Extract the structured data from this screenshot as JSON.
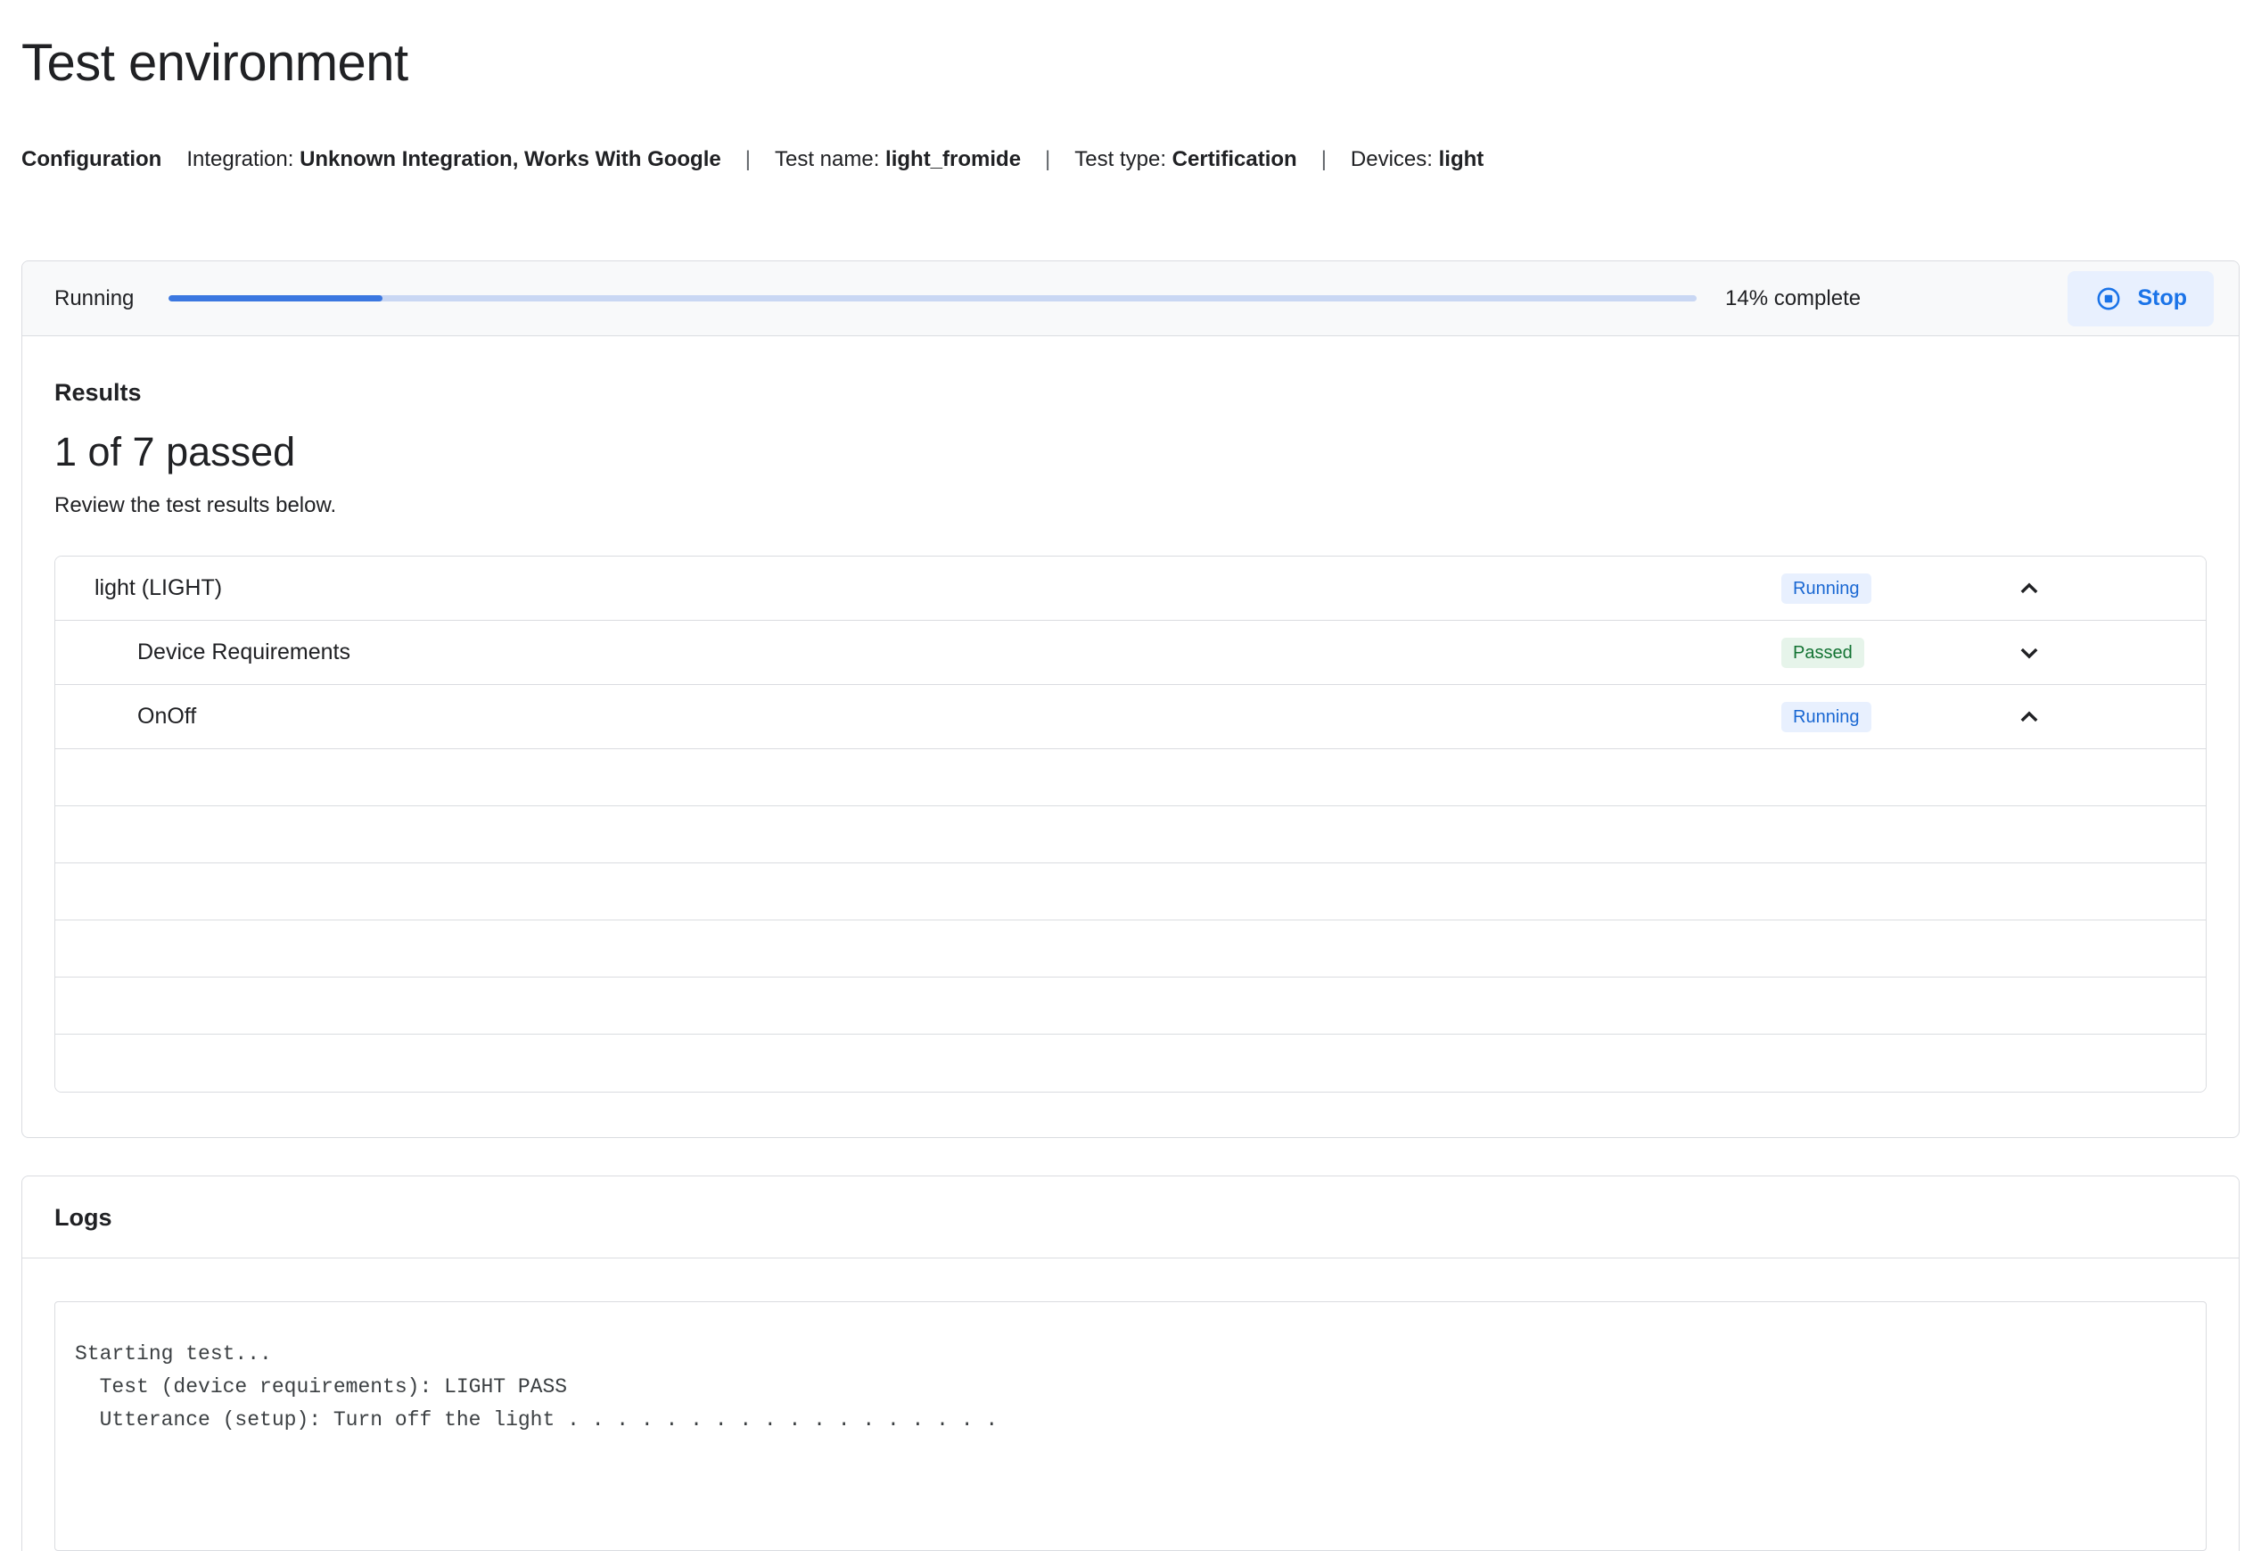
{
  "page": {
    "title": "Test environment"
  },
  "config": {
    "label": "Configuration",
    "separator": "|",
    "items": [
      {
        "label": "Integration: ",
        "value": "Unknown Integration, Works With Google"
      },
      {
        "label": "Test name: ",
        "value": "light_fromide"
      },
      {
        "label": "Test type: ",
        "value": "Certification"
      },
      {
        "label": "Devices: ",
        "value": "light"
      }
    ]
  },
  "progress": {
    "status_label": "Running",
    "percent": 14,
    "percent_label": "14% complete",
    "stop_label": "Stop"
  },
  "results": {
    "heading": "Results",
    "summary": "1 of 7 passed",
    "subtitle": "Review the test results below.",
    "rows": [
      {
        "label": "light (LIGHT)",
        "level": 1,
        "status": "Running",
        "chevron": "up"
      },
      {
        "label": "Device Requirements",
        "level": 2,
        "status": "Passed",
        "chevron": "down"
      },
      {
        "label": "OnOff",
        "level": 2,
        "status": "Running",
        "chevron": "up"
      }
    ],
    "empty_row_count": 6
  },
  "logs": {
    "heading": "Logs",
    "lines": [
      "Starting test...",
      "  Test (device requirements): LIGHT PASS",
      "  Utterance (setup): Turn off the light . . . . . . . . . . . . . . . . . ."
    ]
  },
  "colors": {
    "accent_blue": "#1a73e8",
    "progress_fill": "#3b77e0",
    "progress_track": "#c9d7f3",
    "strip_background": "#f8f9fa",
    "border": "#dadce0",
    "badge_running_bg": "#e8f0fe",
    "badge_running_text": "#1967d2",
    "badge_passed_bg": "#e6f4ea",
    "badge_passed_text": "#137333",
    "text_primary": "#202124"
  }
}
